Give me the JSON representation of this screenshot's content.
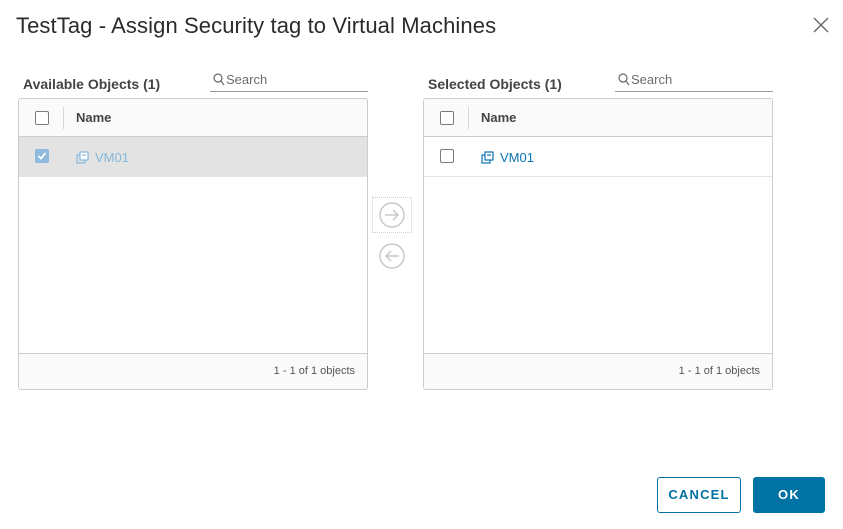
{
  "dialog": {
    "title": "TestTag - Assign Security tag to Virtual Machines",
    "close_icon": "close-icon"
  },
  "available": {
    "label": "Available Objects (1)",
    "search_placeholder": "Search",
    "search_value": "",
    "column_name": "Name",
    "rows": [
      {
        "name": "VM01",
        "checked": true,
        "icon": "vm-icon"
      }
    ],
    "footer": "1 - 1 of 1 objects"
  },
  "selected": {
    "label": "Selected Objects (1)",
    "search_placeholder": "Search",
    "search_value": "",
    "column_name": "Name",
    "rows": [
      {
        "name": "VM01",
        "checked": false,
        "icon": "vm-icon"
      }
    ],
    "footer": "1 - 1 of 1 objects"
  },
  "transfer": {
    "move_right_icon": "arrow-right-circle-icon",
    "move_left_icon": "arrow-left-circle-icon"
  },
  "buttons": {
    "cancel": "CANCEL",
    "ok": "OK"
  },
  "colors": {
    "primary": "#0072a3",
    "link": "#0b72b5",
    "checkbox_checked": "#8fb9dd",
    "row_selected_bg": "#e3e3e3"
  }
}
